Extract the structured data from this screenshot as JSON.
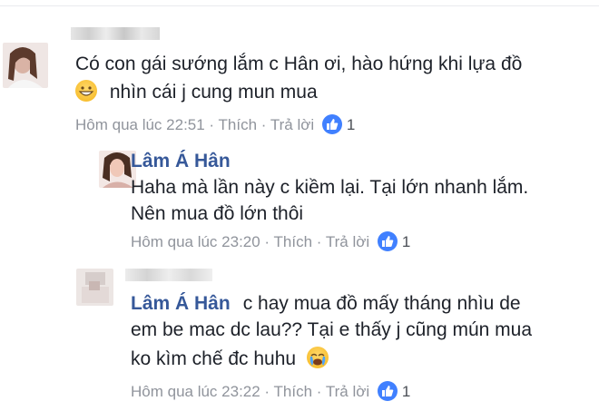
{
  "comments": [
    {
      "lines": [
        "Có con gái sướng lắm c Hân ơi, hào hứng khi lựa đồ",
        "nhìn cái j cung mun mua"
      ],
      "time": "Hôm qua lúc 22:51",
      "like": "Thích",
      "reply": "Trả lời",
      "likes": "1"
    },
    {
      "author": "Lâm Á Hân",
      "lines": [
        "Haha mà lần này c kiềm lại. Tại lớn nhanh lắm.",
        "Nên mua đồ lớn thôi"
      ],
      "time": "Hôm qua lúc 23:20",
      "like": "Thích",
      "reply": "Trả lời",
      "likes": "1"
    },
    {
      "author_tag": "Lâm Á Hân",
      "lines": [
        "c hay mua đồ mấy tháng nhìu de",
        "em be mac dc lau?? Tại e thấy j cũng mún mua",
        "ko kìm chế đc huhu"
      ],
      "time": "Hôm qua lúc 23:22",
      "like": "Thích",
      "reply": "Trả lời",
      "likes": "1"
    }
  ],
  "separator": " · ",
  "colors": {
    "name": "#365899",
    "meta": "#90949c",
    "like_badge": "#4080ff"
  },
  "icons": [
    "like-icon",
    "grinning-emoji-icon",
    "crying-emoji-icon"
  ]
}
